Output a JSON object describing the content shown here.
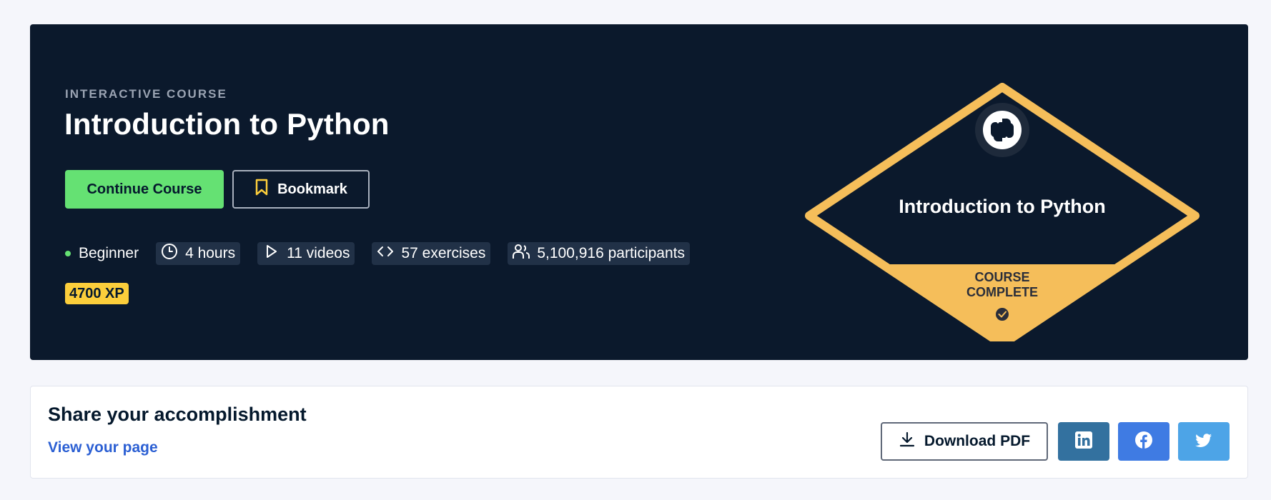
{
  "hero": {
    "eyebrow": "INTERACTIVE COURSE",
    "title": "Introduction to Python",
    "continue_label": "Continue Course",
    "bookmark_label": "Bookmark",
    "stats": {
      "level": "Beginner",
      "duration": "4 hours",
      "videos": "11 videos",
      "exercises": "57 exercises",
      "participants": "5,100,916 participants"
    },
    "xp": "4700 XP"
  },
  "badge": {
    "title": "Introduction to Python",
    "status_line1": "COURSE",
    "status_line2": "COMPLETE",
    "icon": "python-icon"
  },
  "share": {
    "title": "Share your accomplishment",
    "link_label": "View your page",
    "download_label": "Download PDF",
    "socials": [
      "linkedin-icon",
      "facebook-icon",
      "twitter-icon"
    ]
  },
  "colors": {
    "hero_bg": "#0b192c",
    "accent_green": "#65e173",
    "badge_gold": "#f5be5a",
    "xp_yellow": "#fcce3b",
    "linkedin": "#33719f",
    "facebook": "#3f7be3",
    "twitter": "#4da4e7"
  }
}
